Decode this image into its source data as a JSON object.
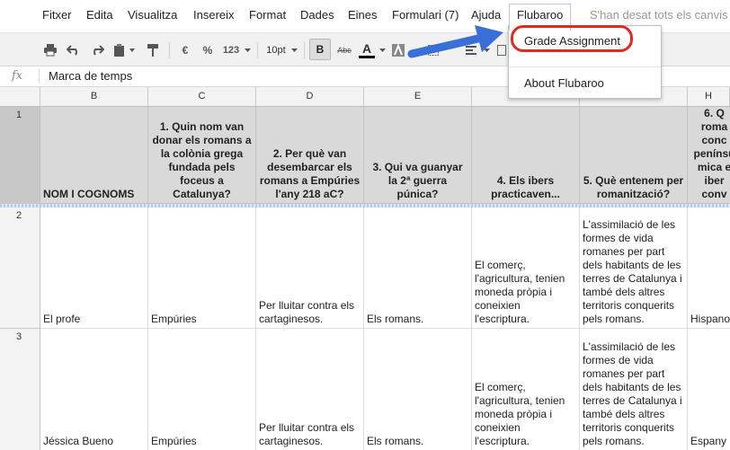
{
  "menubar": {
    "items": [
      "Fitxer",
      "Edita",
      "Visualitza",
      "Insereix",
      "Format",
      "Dades",
      "Eines",
      "Formulari (7)",
      "Ajuda",
      "Flubaroo"
    ],
    "saved_status": "S'han desat tots els canvis"
  },
  "toolbar": {
    "currency": "€",
    "percent": "%",
    "number_format": "123",
    "font_size": "10pt",
    "bold": "B",
    "strikethrough": "Abc",
    "text_color": "A"
  },
  "formula_bar": {
    "fx": "fx",
    "content": "Marca de temps"
  },
  "columns": [
    "B",
    "C",
    "D",
    "E",
    "F",
    "G",
    "H"
  ],
  "rows": [
    {
      "num": "1",
      "cells": [
        "NOM I COGNOMS",
        "1. Quin nom van donar els romans a la colònia grega fundada pels foceus a Catalunya?",
        "2. Per què van desembarcar els romans a Empúries l'any 218 aC?",
        "3. Qui va guanyar la 2ª guerra púnica?",
        "4. Els ibers practicaven...",
        "5. Què entenem per romanització?",
        "6. Q roma conc penínsu mica e iber conv"
      ]
    },
    {
      "num": "2",
      "cells": [
        "El profe",
        "Empúries",
        "Per lluitar contra els cartaginesos.",
        "Els romans.",
        "El comerç, l'agricultura, tenien moneda pròpia i coneixien l'escriptura.",
        "L'assimilació de les formes de vida romanes per part dels habitants de les terres de Catalunya i també dels altres territoris conquerits pels romans.",
        "Hispano"
      ]
    },
    {
      "num": "3",
      "cells": [
        "Jéssica Bueno",
        "Empúries",
        "Per lluitar contra els cartaginesos.",
        "Els romans.",
        "El comerç, l'agricultura, tenien moneda pròpia i coneixien l'escriptura.",
        "L'assimilació de les formes de vida romanes per part dels habitants de les terres de Catalunya i també dels altres territoris conquerits pels romans.",
        "Espany"
      ]
    }
  ],
  "dropdown": {
    "items": [
      "Grade Assignment",
      "About Flubaroo"
    ]
  },
  "colors": {
    "highlight_ring": "#e8281e",
    "arrow": "#3a6fd8",
    "header_cell_bg": "#d9d9d9"
  }
}
